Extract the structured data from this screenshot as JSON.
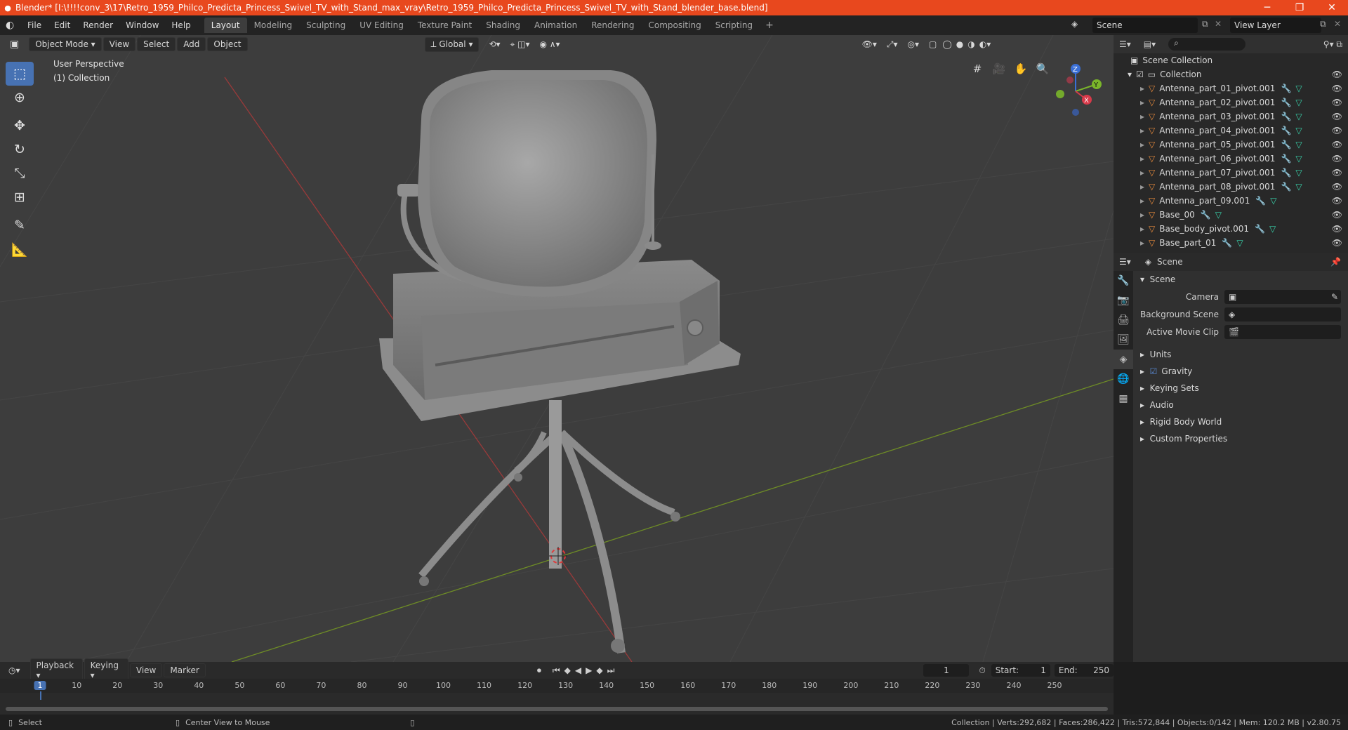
{
  "window": {
    "title": "Blender* [I:\\!!!!conv_3\\17\\Retro_1959_Philco_Predicta_Princess_Swivel_TV_with_Stand_max_vray\\Retro_1959_Philco_Predicta_Princess_Swivel_TV_with_Stand_blender_base.blend]",
    "minimize": "─",
    "maximize": "❐",
    "close": "✕"
  },
  "menu": [
    "File",
    "Edit",
    "Render",
    "Window",
    "Help"
  ],
  "workspaces": [
    "Layout",
    "Modeling",
    "Sculpting",
    "UV Editing",
    "Texture Paint",
    "Shading",
    "Animation",
    "Rendering",
    "Compositing",
    "Scripting"
  ],
  "active_workspace": "Layout",
  "scene_field": "Scene",
  "view_layer_field": "View Layer",
  "viewport": {
    "mode": "Object Mode",
    "menus": [
      "View",
      "Select",
      "Add",
      "Object"
    ],
    "orientation": "Global",
    "perspective_label": "User Perspective",
    "collection_label": "(1) Collection"
  },
  "gizmo_axes": {
    "x": "X",
    "y": "Y",
    "z": "Z"
  },
  "outliner": {
    "root": "Scene Collection",
    "collection": "Collection",
    "items": [
      "Antenna_part_01_pivot.001",
      "Antenna_part_02_pivot.001",
      "Antenna_part_03_pivot.001",
      "Antenna_part_04_pivot.001",
      "Antenna_part_05_pivot.001",
      "Antenna_part_06_pivot.001",
      "Antenna_part_07_pivot.001",
      "Antenna_part_08_pivot.001",
      "Antenna_part_09.001",
      "Base_00",
      "Base_body_pivot.001",
      "Base_part_01"
    ]
  },
  "properties": {
    "header": "Scene",
    "panel": "Scene",
    "camera_label": "Camera",
    "background_scene_label": "Background Scene",
    "active_movie_clip_label": "Active Movie Clip",
    "sections": [
      "Units",
      "Gravity",
      "Keying Sets",
      "Audio",
      "Rigid Body World",
      "Custom Properties"
    ]
  },
  "timeline": {
    "menus": [
      "Playback",
      "Keying",
      "View",
      "Marker"
    ],
    "current_frame": "1",
    "start_label": "Start:",
    "start": "1",
    "end_label": "End:",
    "end": "250",
    "ticks": [
      "1",
      "10",
      "20",
      "30",
      "40",
      "50",
      "60",
      "70",
      "80",
      "90",
      "100",
      "110",
      "120",
      "130",
      "140",
      "150",
      "160",
      "170",
      "180",
      "190",
      "200",
      "210",
      "220",
      "230",
      "240",
      "250"
    ]
  },
  "status": {
    "select": "Select",
    "center_view": "Center View to Mouse",
    "stats": "Collection | Verts:292,682 | Faces:286,422 | Tris:572,844 | Objects:0/142 | Mem: 120.2 MB | v2.80.75"
  }
}
